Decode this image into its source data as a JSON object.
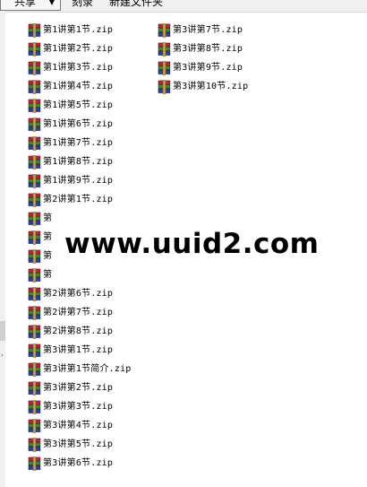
{
  "toolbar": {
    "share": "共享",
    "burn": "刻录",
    "new_folder": "新建文件夹"
  },
  "files_col1": [
    "第1讲第1节.zip",
    "第1讲第2节.zip",
    "第1讲第3节.zip",
    "第1讲第4节.zip",
    "第1讲第5节.zip",
    "第1讲第6节.zip",
    "第1讲第7节.zip",
    "第1讲第8节.zip",
    "第1讲第9节.zip",
    "第2讲第1节.zip",
    "第",
    "第",
    "第",
    "第",
    "第2讲第6节.zip",
    "第2讲第7节.zip",
    "第2讲第8节.zip",
    "第3讲第1节.zip",
    "第3讲第1节简介.zip",
    "第3讲第2节.zip",
    "第3讲第3节.zip",
    "第3讲第4节.zip",
    "第3讲第5节.zip",
    "第3讲第6节.zip"
  ],
  "files_col2": [
    "第3讲第7节.zip",
    "第3讲第8节.zip",
    "第3讲第9节.zip",
    "第3讲第10节.zip"
  ],
  "watermark": "www.uuid2.com",
  "icons": {
    "file": "winrar-archive-icon"
  },
  "colors": {
    "book_red": "#c2233a",
    "book_green": "#3d8a2c",
    "book_blue": "#2d3f9e",
    "toolbar_bg": "#f0f0f0"
  }
}
